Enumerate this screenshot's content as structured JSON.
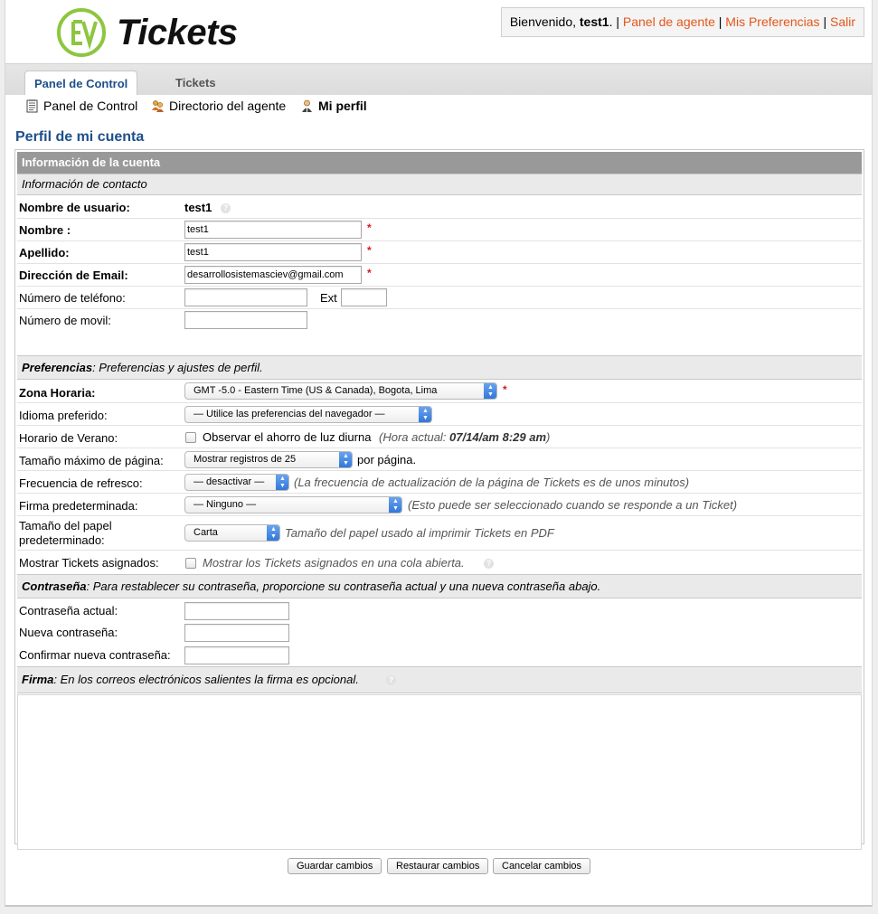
{
  "header": {
    "logo_text": "Tickets",
    "welcome_prefix": "Bienvenido, ",
    "username": "test1",
    "welcome_suffix": ".",
    "sep": "|",
    "links": [
      "Panel de agente",
      "Mis Preferencias",
      "Salir"
    ]
  },
  "tabs": [
    {
      "label": "Panel de Control",
      "active": true
    },
    {
      "label": "Tickets",
      "active": false
    }
  ],
  "subnav": [
    {
      "label": "Panel de Control",
      "icon": "document-icon"
    },
    {
      "label": "Directorio del agente",
      "icon": "people-icon"
    },
    {
      "label": "Mi perfil",
      "icon": "person-icon",
      "active": true
    }
  ],
  "page_title": "Perfil de mi cuenta",
  "section_account": "Información de la cuenta",
  "section_contact": "Información de contacto",
  "fields": {
    "username_label": "Nombre de usuario:",
    "username_value": "test1",
    "firstname_label": "Nombre :",
    "firstname_value": "test1",
    "lastname_label": "Apellido:",
    "lastname_value": "test1",
    "email_label": "Dirección de Email:",
    "email_value": "desarrollosistemasciev@gmail.com",
    "phone_label": "Número de teléfono:",
    "phone_value": "",
    "ext_label": "Ext",
    "ext_value": "",
    "mobile_label": "Número de movil:",
    "mobile_value": "",
    "required_mark": "*"
  },
  "prefs": {
    "header_bold": "Preferencias",
    "header_rest": ": Preferencias y ajustes de perfil.",
    "timezone_label": "Zona Horaria:",
    "timezone_value": "GMT -5.0 - Eastern Time (US & Canada), Bogota, Lima",
    "language_label": "Idioma preferido:",
    "language_value": "— Utilice las preferencias del navegador —",
    "dst_label": "Horario de Verano:",
    "dst_checkbox_label": "Observar el ahorro de luz diurna",
    "dst_hint_prefix": "(Hora actual: ",
    "dst_hint_time": "07/14/am 8:29 am",
    "dst_hint_suffix": ")",
    "pagesize_label": "Tamaño máximo de página:",
    "pagesize_value": "Mostrar registros de 25",
    "pagesize_suffix": "por página.",
    "refresh_label": "Frecuencia de refresco:",
    "refresh_value": "— desactivar —",
    "refresh_hint": "(La frecuencia de actualización de la página de Tickets es de unos minutos)",
    "signature_label": "Firma predeterminada:",
    "signature_value": "— Ninguno —",
    "signature_hint": "(Esto puede ser seleccionado cuando se responde a un Ticket)",
    "paper_label_1": "Tamaño del papel",
    "paper_label_2": "predeterminado:",
    "paper_value": "Carta",
    "paper_hint": "Tamaño del papel usado al imprimir Tickets en PDF",
    "assigned_label": "Mostrar Tickets asignados:",
    "assigned_hint": "Mostrar los Tickets asignados en una cola abierta."
  },
  "password": {
    "header_bold": "Contraseña",
    "header_rest": ": Para restablecer su contraseña, proporcione su contraseña actual y una nueva contraseña abajo.",
    "current_label": "Contraseña actual:",
    "new_label": "Nueva contraseña:",
    "confirm_label": "Confirmar nueva contraseña:"
  },
  "signature": {
    "header_bold": "Firma",
    "header_rest": ": En los correos electrónicos salientes la firma es opcional.",
    "value": ""
  },
  "buttons": [
    "Guardar cambios",
    "Restaurar cambios",
    "Cancelar cambios"
  ],
  "colors": {
    "link": "#e3571c",
    "title": "#1d4f8b",
    "required": "#d31a1a",
    "logo_green": "#8dc63f"
  }
}
